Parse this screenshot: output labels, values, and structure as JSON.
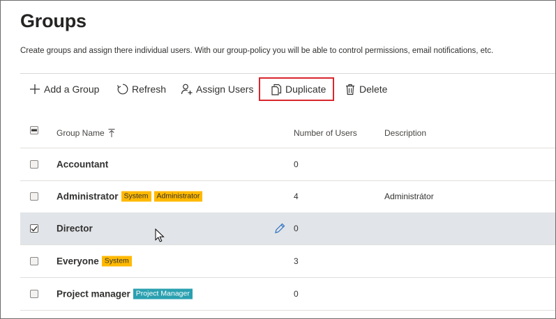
{
  "page": {
    "title": "Groups",
    "description": "Create groups and assign there individual users. With our group-policy you will be able to control permissions, email notifications, etc."
  },
  "toolbar": {
    "add_label": "Add a Group",
    "add_icon": "plus-icon",
    "refresh_label": "Refresh",
    "refresh_icon": "refresh-icon",
    "assign_label": "Assign Users",
    "assign_icon": "add-user-icon",
    "duplicate_label": "Duplicate",
    "duplicate_icon": "copy-icon",
    "delete_label": "Delete",
    "delete_icon": "trash-icon",
    "highlight_color": "#d9262d"
  },
  "grid": {
    "columns": {
      "name": "Group Name",
      "users": "Number of Users",
      "description": "Description"
    },
    "sort": {
      "column": "name",
      "direction": "ascending"
    },
    "select_all_state": "indeterminate",
    "rows": [
      {
        "name": "Accountant",
        "badges": [],
        "users": "0",
        "description": "",
        "checked": false
      },
      {
        "name": "Administrator",
        "badges": [
          "System",
          "Administrator"
        ],
        "users": "4",
        "description": "Administrátor",
        "checked": false
      },
      {
        "name": "Director",
        "badges": [],
        "users": "0",
        "description": "",
        "checked": true
      },
      {
        "name": "Everyone",
        "badges": [
          "System"
        ],
        "users": "3",
        "description": "",
        "checked": false
      },
      {
        "name": "Project manager",
        "badges": [
          "Project Manager"
        ],
        "users": "0",
        "description": "",
        "checked": false
      }
    ]
  },
  "colors": {
    "badge_yellow": "#ffb900",
    "badge_teal": "#2aa0b0",
    "selected_row": "#e1e4e8",
    "edit_icon": "#2b6fc2"
  }
}
